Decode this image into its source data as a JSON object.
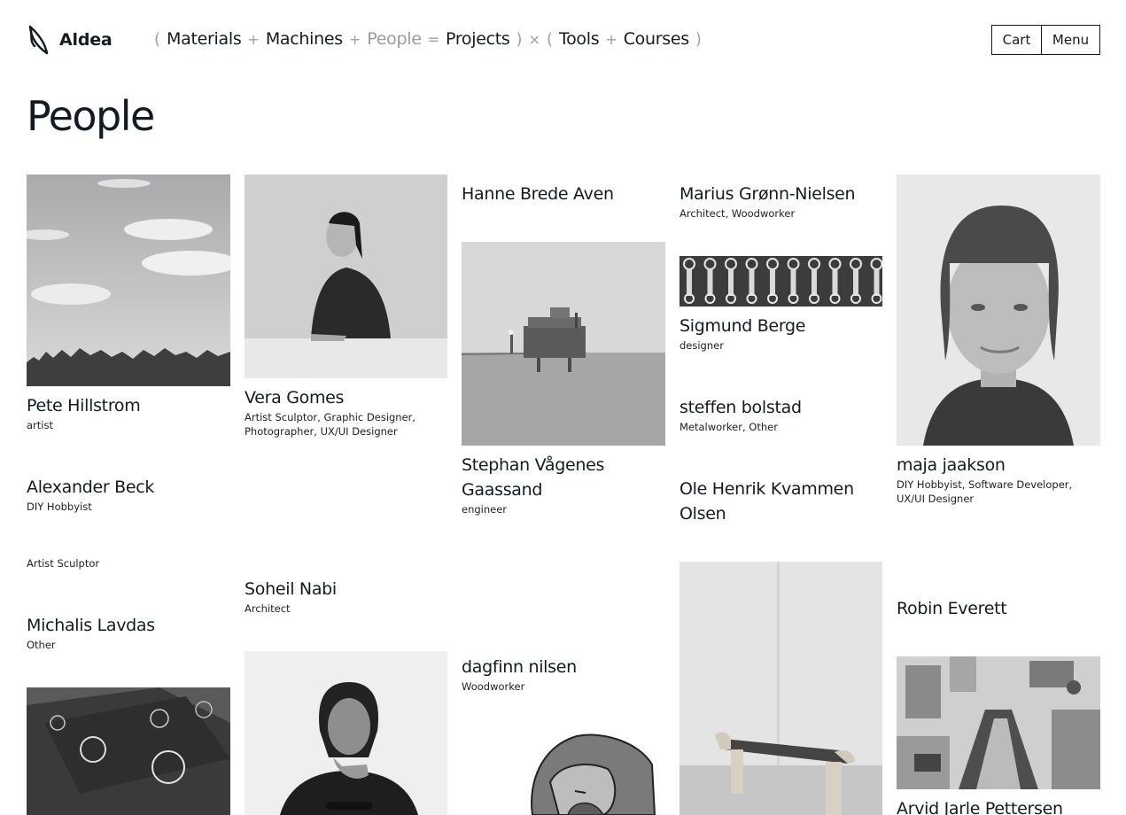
{
  "header": {
    "logo_text": "Aldea",
    "nav": {
      "open_paren": "(",
      "close_paren": ")",
      "items": [
        "Materials",
        "Machines",
        "People",
        "Projects",
        "Tools",
        "Courses"
      ],
      "ops": [
        "+",
        "+",
        "=",
        "×",
        "+"
      ],
      "active": "People"
    },
    "cart_label": "Cart",
    "menu_label": "Menu"
  },
  "page": {
    "title": "People"
  },
  "people": [
    {
      "name": "Pete Hillstrom",
      "role": "artist"
    },
    {
      "name": "Vera Gomes",
      "role": "Artist Sculptor, Graphic Designer, Photographer, UX/UI Designer"
    },
    {
      "name": "Hanne Brede Aven",
      "role": ""
    },
    {
      "name": "Marius Grønn-Nielsen",
      "role": "Architect, Woodworker"
    },
    {
      "name": "maja jaakson",
      "role": "DIY Hobbyist, Software Developer, UX/UI Designer"
    },
    {
      "name": "Stephan Vågenes Gaassand",
      "role": "engineer"
    },
    {
      "name": "Sigmund Berge",
      "role": "designer"
    },
    {
      "name": "steffen bolstad",
      "role": "Metalworker, Other"
    },
    {
      "name": "Alexander Beck",
      "role": "DIY Hobbyist"
    },
    {
      "name": "Ole Henrik Kvammen Olsen",
      "role": ""
    },
    {
      "name": "",
      "role": "Artist Sculptor"
    },
    {
      "name": "Soheil Nabi",
      "role": "Architect"
    },
    {
      "name": "Robin Everett",
      "role": ""
    },
    {
      "name": "Michalis Lavdas",
      "role": "Other"
    },
    {
      "name": "dagfinn nilsen",
      "role": "Woodworker"
    },
    {
      "name": "Arvid Jarle Pettersen",
      "role": ""
    }
  ]
}
